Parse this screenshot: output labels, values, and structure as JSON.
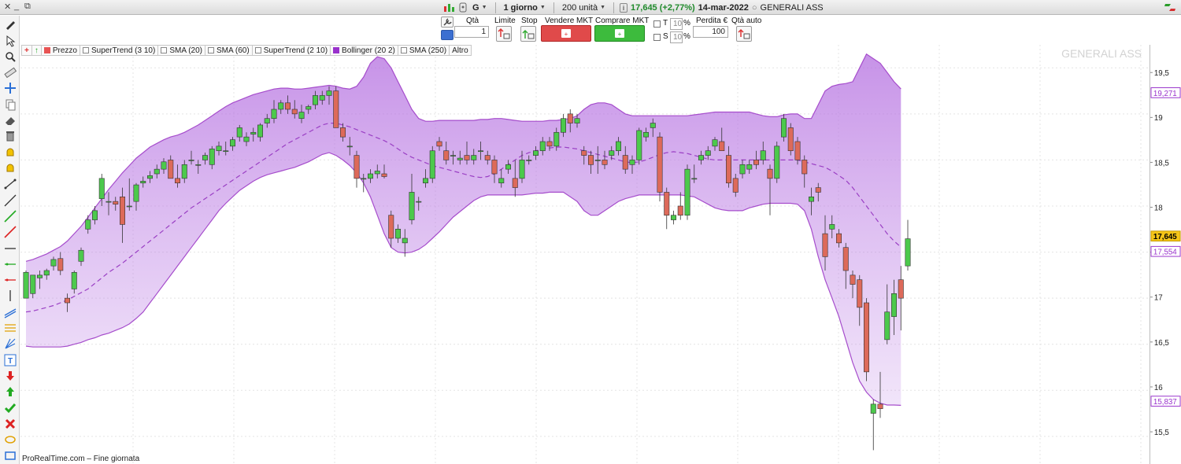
{
  "titlebar": {
    "timeframe": "1 giorno",
    "units": "200 unità",
    "price_change": "17,645 (+2,77%)",
    "date": "14-mar-2022",
    "instrument": "GENERALI ASS",
    "ticker_letter": "G"
  },
  "order_bar": {
    "qty_label": "Qtà",
    "qty_value": "1",
    "limit_label": "Limite",
    "stop_label": "Stop",
    "sell_label": "Vendere MKT",
    "buy_label": "Comprare MKT",
    "t_label": "T",
    "t_value": "10",
    "s_label": "S",
    "s_value": "10",
    "pct": "%",
    "loss_label": "Perdita €",
    "loss_value": "100",
    "qty_auto_label": "Qtà auto"
  },
  "legend": [
    {
      "label": "Prezzo",
      "color": "#e85454"
    },
    {
      "label": "SuperTrend (3 10)",
      "color": ""
    },
    {
      "label": "SMA (20)",
      "color": ""
    },
    {
      "label": "SMA (60)",
      "color": ""
    },
    {
      "label": "SuperTrend (2 10)",
      "color": ""
    },
    {
      "label": "Bollinger (20 2)",
      "color": "#9932cc"
    },
    {
      "label": "SMA (250)",
      "color": ""
    },
    {
      "label": "Altro",
      "color": ""
    }
  ],
  "watermark": "GENERALI ASS",
  "footer": "ProRealTime.com – Fine giornata",
  "colors": {
    "bull": "#4cc94c",
    "bear": "#dd6a5a",
    "band": "#a64dcc",
    "price_tag": "#f5c518",
    "upper_tag": "#9932cc",
    "mid_tag": "#9932cc"
  },
  "chart_data": {
    "type": "candlestick",
    "ylim": [
      15.2,
      19.75
    ],
    "y_ticks": [
      "15,5",
      "16",
      "16,5",
      "17",
      "17,5",
      "18",
      "18,5",
      "19",
      "19,5"
    ],
    "y_tick_values": [
      15.5,
      16,
      16.5,
      17,
      17.5,
      18,
      18.5,
      19,
      19.5
    ],
    "last_price_label": "17,645",
    "upper_band_label": "19,271",
    "middle_band_label": "17,554",
    "lower_band_label": "15,837",
    "last_price": 17.645,
    "upper_value": 19.271,
    "middle_value": 17.554,
    "lower_value": 15.837,
    "candles": [
      [
        17.0,
        17.3,
        17.0,
        17.28
      ],
      [
        17.05,
        17.25,
        17.0,
        17.25
      ],
      [
        17.22,
        17.3,
        17.1,
        17.25
      ],
      [
        17.25,
        17.32,
        17.2,
        17.3
      ],
      [
        17.35,
        17.45,
        17.3,
        17.42
      ],
      [
        17.43,
        17.5,
        17.25,
        17.3
      ],
      [
        17.0,
        17.05,
        16.85,
        16.95
      ],
      [
        17.1,
        17.3,
        17.05,
        17.28
      ],
      [
        17.4,
        17.55,
        17.35,
        17.52
      ],
      [
        17.75,
        17.9,
        17.7,
        17.85
      ],
      [
        17.85,
        18.0,
        17.8,
        17.95
      ],
      [
        18.08,
        18.35,
        18.0,
        18.3
      ],
      [
        18.05,
        18.15,
        17.9,
        18.05
      ],
      [
        18.05,
        18.1,
        17.95,
        18.02
      ],
      [
        18.1,
        18.2,
        17.6,
        17.8
      ],
      [
        18.0,
        18.3,
        17.95,
        18.0
      ],
      [
        18.05,
        18.25,
        17.95,
        18.23
      ],
      [
        18.25,
        18.32,
        18.2,
        18.27
      ],
      [
        18.3,
        18.38,
        18.25,
        18.33
      ],
      [
        18.35,
        18.45,
        18.3,
        18.4
      ],
      [
        18.4,
        18.52,
        18.35,
        18.48
      ],
      [
        18.5,
        18.55,
        18.3,
        18.3
      ],
      [
        18.3,
        18.45,
        18.2,
        18.25
      ],
      [
        18.3,
        18.5,
        18.25,
        18.45
      ],
      [
        18.5,
        18.6,
        18.45,
        18.5
      ],
      [
        18.45,
        18.5,
        18.35,
        18.45
      ],
      [
        18.5,
        18.58,
        18.45,
        18.55
      ],
      [
        18.45,
        18.65,
        18.4,
        18.62
      ],
      [
        18.6,
        18.7,
        18.55,
        18.65
      ],
      [
        18.6,
        18.7,
        18.55,
        18.6
      ],
      [
        18.65,
        18.75,
        18.6,
        18.72
      ],
      [
        18.75,
        18.88,
        18.7,
        18.85
      ],
      [
        18.7,
        18.8,
        18.65,
        18.75
      ],
      [
        18.78,
        18.85,
        18.7,
        18.8
      ],
      [
        18.75,
        18.9,
        18.7,
        18.88
      ],
      [
        18.9,
        19.0,
        18.85,
        18.95
      ],
      [
        18.95,
        19.15,
        18.9,
        19.05
      ],
      [
        19.05,
        19.15,
        19.0,
        19.12
      ],
      [
        19.12,
        19.2,
        19.0,
        19.05
      ],
      [
        19.05,
        19.15,
        18.95,
        19.0
      ],
      [
        18.95,
        19.1,
        18.9,
        19.02
      ],
      [
        19.05,
        19.1,
        19.0,
        19.08
      ],
      [
        19.1,
        19.25,
        19.05,
        19.2
      ],
      [
        19.15,
        19.25,
        19.1,
        19.2
      ],
      [
        19.2,
        19.3,
        19.1,
        19.25
      ],
      [
        19.25,
        19.3,
        18.85,
        18.85
      ],
      [
        18.85,
        18.9,
        18.7,
        18.75
      ],
      [
        18.65,
        18.75,
        18.55,
        18.65
      ],
      [
        18.55,
        18.6,
        18.2,
        18.3
      ],
      [
        18.3,
        18.35,
        18.15,
        18.3
      ],
      [
        18.3,
        18.4,
        18.25,
        18.35
      ],
      [
        18.35,
        18.45,
        18.3,
        18.38
      ],
      [
        18.35,
        18.45,
        18.3,
        18.32
      ],
      [
        17.9,
        17.95,
        17.55,
        17.65
      ],
      [
        17.65,
        17.8,
        17.6,
        17.75
      ],
      [
        17.6,
        17.75,
        17.45,
        17.65
      ],
      [
        17.85,
        18.35,
        17.8,
        18.15
      ],
      [
        18.05,
        18.1,
        17.95,
        18.05
      ],
      [
        18.25,
        18.4,
        18.2,
        18.3
      ],
      [
        18.3,
        18.65,
        18.25,
        18.6
      ],
      [
        18.7,
        18.75,
        18.6,
        18.65
      ],
      [
        18.6,
        18.7,
        18.45,
        18.5
      ],
      [
        18.55,
        18.6,
        18.45,
        18.55
      ],
      [
        18.5,
        18.6,
        18.45,
        18.52
      ],
      [
        18.55,
        18.7,
        18.45,
        18.5
      ],
      [
        18.5,
        18.62,
        18.45,
        18.55
      ],
      [
        18.6,
        18.7,
        18.5,
        18.6
      ],
      [
        18.55,
        18.6,
        18.45,
        18.5
      ],
      [
        18.5,
        18.55,
        18.25,
        18.35
      ],
      [
        18.25,
        18.4,
        18.2,
        18.3
      ],
      [
        18.4,
        18.5,
        18.35,
        18.45
      ],
      [
        18.3,
        18.5,
        18.1,
        18.2
      ],
      [
        18.3,
        18.6,
        18.25,
        18.5
      ],
      [
        18.5,
        18.55,
        18.45,
        18.5
      ],
      [
        18.55,
        18.65,
        18.5,
        18.6
      ],
      [
        18.6,
        18.75,
        18.55,
        18.7
      ],
      [
        18.7,
        18.75,
        18.6,
        18.65
      ],
      [
        18.65,
        18.85,
        18.6,
        18.8
      ],
      [
        18.8,
        19.0,
        18.75,
        18.95
      ],
      [
        19.0,
        19.05,
        18.8,
        18.9
      ],
      [
        18.9,
        19.0,
        18.85,
        18.95
      ],
      [
        18.6,
        18.65,
        18.45,
        18.55
      ],
      [
        18.55,
        18.6,
        18.35,
        18.45
      ],
      [
        18.5,
        18.65,
        18.35,
        18.5
      ],
      [
        18.5,
        18.6,
        18.4,
        18.45
      ],
      [
        18.55,
        18.65,
        18.5,
        18.6
      ],
      [
        18.6,
        18.75,
        18.55,
        18.7
      ],
      [
        18.55,
        18.65,
        18.35,
        18.4
      ],
      [
        18.45,
        18.55,
        18.35,
        18.5
      ],
      [
        18.5,
        18.85,
        18.45,
        18.82
      ],
      [
        18.75,
        18.85,
        18.7,
        18.8
      ],
      [
        18.85,
        18.95,
        18.75,
        18.9
      ],
      [
        18.75,
        18.8,
        18.05,
        18.15
      ],
      [
        18.15,
        18.2,
        17.75,
        17.9
      ],
      [
        17.85,
        17.95,
        17.8,
        17.9
      ],
      [
        18.0,
        18.15,
        17.85,
        17.9
      ],
      [
        17.9,
        18.45,
        17.85,
        18.4
      ],
      [
        18.3,
        18.45,
        18.25,
        18.3
      ],
      [
        18.5,
        18.6,
        18.45,
        18.55
      ],
      [
        18.55,
        18.65,
        18.5,
        18.6
      ],
      [
        18.65,
        18.75,
        18.6,
        18.72
      ],
      [
        18.7,
        18.85,
        18.6,
        18.6
      ],
      [
        18.55,
        18.65,
        18.2,
        18.25
      ],
      [
        18.3,
        18.35,
        18.1,
        18.15
      ],
      [
        18.35,
        18.5,
        18.3,
        18.45
      ],
      [
        18.4,
        18.5,
        18.35,
        18.45
      ],
      [
        18.5,
        18.6,
        18.4,
        18.45
      ],
      [
        18.5,
        18.7,
        18.45,
        18.6
      ],
      [
        18.4,
        18.45,
        17.9,
        18.3
      ],
      [
        18.3,
        18.7,
        18.25,
        18.65
      ],
      [
        18.75,
        19.0,
        18.7,
        18.95
      ],
      [
        18.85,
        18.9,
        18.55,
        18.6
      ],
      [
        18.7,
        18.75,
        18.45,
        18.5
      ],
      [
        18.5,
        18.55,
        18.2,
        18.35
      ],
      [
        18.05,
        18.2,
        17.9,
        18.1
      ],
      [
        18.2,
        18.25,
        18.05,
        18.15
      ],
      [
        17.7,
        17.9,
        17.3,
        17.45
      ],
      [
        17.75,
        17.9,
        17.65,
        17.8
      ],
      [
        17.7,
        17.75,
        17.55,
        17.6
      ],
      [
        17.55,
        17.6,
        17.1,
        17.3
      ],
      [
        17.25,
        17.3,
        17.0,
        17.15
      ],
      [
        17.2,
        17.25,
        16.7,
        16.9
      ],
      [
        16.95,
        17.0,
        16.1,
        16.2
      ],
      [
        15.75,
        15.9,
        15.35,
        15.85
      ],
      [
        15.85,
        16.2,
        15.7,
        15.8
      ],
      [
        16.55,
        17.15,
        16.5,
        16.85
      ],
      [
        16.8,
        17.2,
        16.6,
        17.05
      ],
      [
        17.2,
        17.35,
        16.65,
        17.0
      ],
      [
        17.35,
        17.85,
        17.3,
        17.645
      ]
    ],
    "middle_band": [
      16.85,
      16.86,
      16.88,
      16.9,
      16.92,
      16.95,
      16.98,
      17.02,
      17.06,
      17.1,
      17.16,
      17.22,
      17.28,
      17.33,
      17.38,
      17.44,
      17.5,
      17.56,
      17.62,
      17.68,
      17.74,
      17.8,
      17.86,
      17.92,
      17.98,
      18.03,
      18.08,
      18.13,
      18.18,
      18.23,
      18.28,
      18.33,
      18.38,
      18.43,
      18.48,
      18.53,
      18.58,
      18.63,
      18.68,
      18.72,
      18.76,
      18.8,
      18.84,
      18.88,
      18.9,
      18.9,
      18.88,
      18.86,
      18.83,
      18.8,
      18.77,
      18.74,
      18.71,
      18.67,
      18.62,
      18.57,
      18.53,
      18.5,
      18.47,
      18.44,
      18.42,
      18.4,
      18.38,
      18.36,
      18.34,
      18.32,
      18.31,
      18.32,
      18.35,
      18.4,
      18.45,
      18.5,
      18.55,
      18.58,
      18.6,
      18.62,
      18.63,
      18.64,
      18.64,
      18.63,
      18.62,
      18.6,
      18.58,
      18.56,
      18.54,
      18.52,
      18.5,
      18.48,
      18.47,
      18.48,
      18.5,
      18.53,
      18.56,
      18.58,
      18.59,
      18.58,
      18.57,
      18.55,
      18.53,
      18.51,
      18.5,
      18.5,
      18.5,
      18.5,
      18.5,
      18.5,
      18.5,
      18.5,
      18.5,
      18.5,
      18.5,
      18.5,
      18.5,
      18.48,
      18.46,
      18.44,
      18.42,
      18.38,
      18.33,
      18.28,
      18.2,
      18.1,
      18.0,
      17.9,
      17.8,
      17.7,
      17.62,
      17.554
    ],
    "upper_band": [
      17.4,
      17.42,
      17.45,
      17.48,
      17.52,
      17.56,
      17.62,
      17.7,
      17.78,
      17.88,
      17.98,
      18.08,
      18.18,
      18.27,
      18.36,
      18.44,
      18.52,
      18.58,
      18.64,
      18.68,
      18.72,
      18.75,
      18.77,
      18.8,
      18.84,
      18.88,
      18.93,
      18.98,
      19.03,
      19.08,
      19.12,
      19.15,
      19.18,
      19.21,
      19.23,
      19.25,
      19.27,
      19.28,
      19.28,
      19.27,
      19.27,
      19.28,
      19.29,
      19.3,
      19.31,
      19.3,
      19.28,
      19.27,
      19.3,
      19.4,
      19.55,
      19.62,
      19.6,
      19.5,
      19.35,
      19.2,
      19.05,
      18.95,
      18.92,
      18.92,
      18.93,
      18.93,
      18.93,
      18.93,
      18.93,
      18.93,
      18.94,
      18.94,
      18.95,
      18.95,
      18.94,
      18.93,
      18.92,
      18.92,
      18.92,
      18.92,
      18.93,
      18.93,
      18.94,
      18.95,
      18.98,
      19.05,
      19.1,
      19.12,
      19.12,
      19.1,
      19.05,
      19.0,
      18.98,
      18.98,
      18.98,
      18.98,
      18.98,
      18.98,
      18.98,
      18.98,
      18.98,
      18.99,
      19.0,
      19.01,
      19.02,
      19.02,
      19.02,
      19.02,
      19.02,
      19.02,
      19.0,
      18.98,
      18.97,
      18.97,
      18.99,
      19.0,
      19.0,
      18.95,
      18.95,
      19.1,
      19.25,
      19.3,
      19.32,
      19.33,
      19.35,
      19.5,
      19.65,
      19.6,
      19.55,
      19.45,
      19.35,
      19.271
    ],
    "lower_band": [
      16.48,
      16.47,
      16.47,
      16.47,
      16.47,
      16.47,
      16.48,
      16.5,
      16.52,
      16.55,
      16.57,
      16.6,
      16.62,
      16.65,
      16.68,
      16.72,
      16.78,
      16.85,
      16.95,
      17.05,
      17.15,
      17.25,
      17.35,
      17.45,
      17.55,
      17.65,
      17.75,
      17.85,
      17.95,
      18.03,
      18.1,
      18.17,
      18.22,
      18.27,
      18.31,
      18.34,
      18.36,
      18.38,
      18.4,
      18.42,
      18.45,
      18.48,
      18.52,
      18.56,
      18.58,
      18.55,
      18.5,
      18.44,
      18.36,
      18.25,
      18.1,
      17.9,
      17.7,
      17.55,
      17.5,
      17.49,
      17.5,
      17.53,
      17.58,
      17.65,
      17.72,
      17.8,
      17.88,
      17.94,
      18.0,
      18.06,
      18.1,
      18.12,
      18.12,
      18.12,
      18.12,
      18.12,
      18.12,
      18.13,
      18.14,
      18.14,
      18.15,
      18.15,
      18.15,
      18.1,
      18.05,
      17.95,
      17.9,
      17.9,
      17.95,
      18.0,
      18.05,
      18.08,
      18.1,
      18.12,
      18.12,
      18.12,
      18.12,
      18.12,
      18.12,
      18.12,
      18.11,
      18.1,
      18.06,
      18.02,
      17.98,
      17.96,
      17.95,
      17.95,
      17.95,
      17.98,
      18.0,
      18.02,
      18.03,
      18.03,
      18.03,
      18.03,
      18.02,
      17.95,
      17.75,
      17.45,
      17.2,
      17.0,
      16.8,
      16.55,
      16.3,
      16.1,
      15.98,
      15.9,
      15.86,
      15.84,
      15.84,
      15.837
    ]
  }
}
